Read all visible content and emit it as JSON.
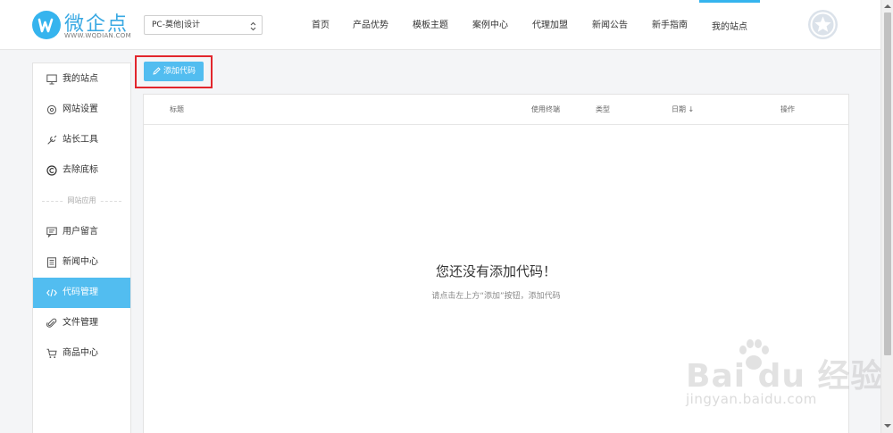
{
  "header": {
    "logo_name": "微企点",
    "logo_url": "WWW.WQDIAN.COM",
    "site_select": {
      "value": "PC-莫他|设计"
    },
    "nav": [
      {
        "label": "首页"
      },
      {
        "label": "产品优势"
      },
      {
        "label": "模板主题"
      },
      {
        "label": "案例中心"
      },
      {
        "label": "代理加盟"
      },
      {
        "label": "新闻公告"
      },
      {
        "label": "新手指南"
      },
      {
        "label": "我的站点",
        "active": true
      }
    ]
  },
  "sidebar": {
    "items": [
      {
        "label": "我的站点",
        "icon": "monitor-icon"
      },
      {
        "label": "网站设置",
        "icon": "gear-icon"
      },
      {
        "label": "站长工具",
        "icon": "wrench-icon"
      },
      {
        "label": "去除底标",
        "icon": "copyright-icon"
      }
    ],
    "divider_label": "网站应用",
    "app_items": [
      {
        "label": "用户留言",
        "icon": "message-icon"
      },
      {
        "label": "新闻中心",
        "icon": "news-icon"
      },
      {
        "label": "代码管理",
        "icon": "code-icon",
        "active": true
      },
      {
        "label": "文件管理",
        "icon": "paperclip-icon"
      },
      {
        "label": "商品中心",
        "icon": "cart-icon"
      }
    ]
  },
  "toolbar": {
    "add_label": "添加代码"
  },
  "table": {
    "columns": [
      "标题",
      "使用终端",
      "类型",
      "日期 ↓",
      "操作"
    ],
    "empty_title": "您还没有添加代码！",
    "empty_hint": "请点击左上方“添加”按钮，添加代码"
  },
  "watermark": {
    "text": "Bai du 经验",
    "url": "jingyan.baidu.com"
  },
  "colors": {
    "accent": "#52bdf0",
    "brand": "#35b4ee",
    "highlight": "#e2262d"
  }
}
